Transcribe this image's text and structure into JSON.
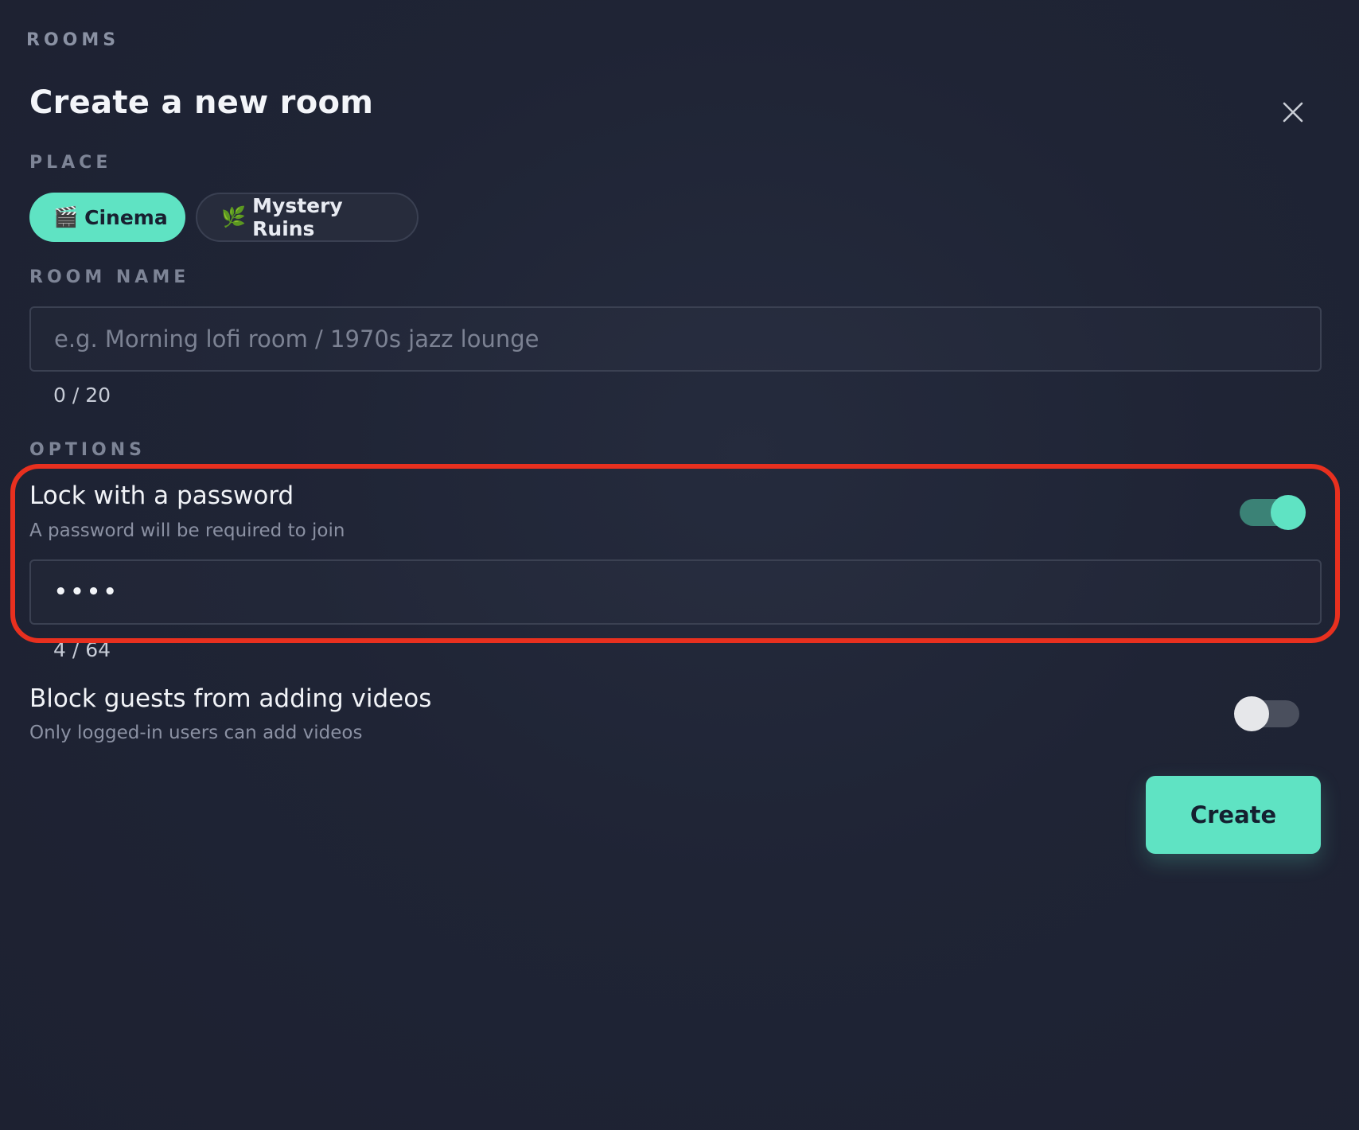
{
  "header": {
    "section": "ROOMS",
    "title": "Create a new room"
  },
  "place": {
    "label": "PLACE",
    "options": [
      {
        "emoji": "🎬",
        "label": "Cinema",
        "selected": true
      },
      {
        "emoji": "🌿",
        "label": "Mystery Ruins",
        "selected": false
      }
    ]
  },
  "room_name": {
    "label": "ROOM NAME",
    "value": "",
    "placeholder": "e.g. Morning lofi room / 1970s jazz lounge",
    "counter": "0 / 20"
  },
  "options": {
    "label": "OPTIONS",
    "lock": {
      "title": "Lock with a password",
      "description": "A password will be required to join",
      "enabled": true,
      "password_masked": "••••",
      "counter": "4 / 64"
    },
    "block_guests": {
      "title": "Block guests from adding videos",
      "description": "Only logged-in users can add videos",
      "enabled": false
    }
  },
  "actions": {
    "create_label": "Create"
  },
  "icons": {
    "close": "close-icon"
  },
  "colors": {
    "background": "#1e2233",
    "accent": "#5fe3c3",
    "highlight": "#e8301f"
  }
}
